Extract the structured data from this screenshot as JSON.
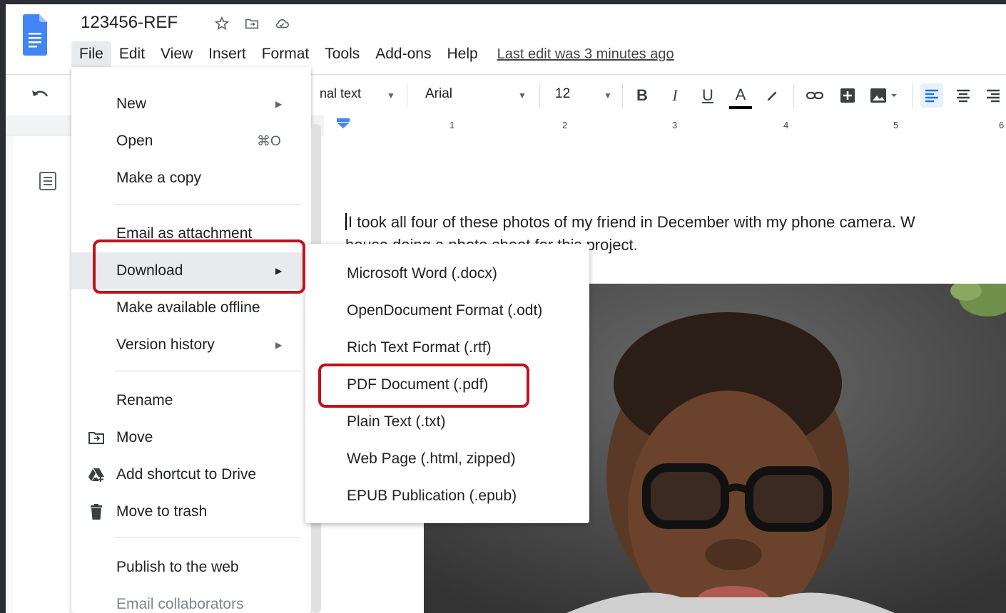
{
  "doc": {
    "title": "123456-REF",
    "last_edit": "Last edit was 3 minutes ago",
    "body_line1": "I took all four of these photos of my friend in December with my phone camera.  W",
    "body_line2": "house doing a photo shoot for this project."
  },
  "menubar": {
    "items": [
      "File",
      "Edit",
      "View",
      "Insert",
      "Format",
      "Tools",
      "Add-ons",
      "Help"
    ]
  },
  "toolbar": {
    "style": "nal text",
    "font": "Arial",
    "size": "12",
    "bold": "B",
    "italic": "I",
    "underline": "U",
    "text_color": "A"
  },
  "ruler": {
    "numbers": [
      "1",
      "2",
      "3",
      "4",
      "5",
      "6"
    ]
  },
  "file_menu": {
    "new": "New",
    "open": "Open",
    "open_shortcut": "⌘O",
    "make_copy": "Make a copy",
    "email_attachment": "Email as attachment",
    "download": "Download",
    "offline": "Make available offline",
    "version_history": "Version history",
    "rename": "Rename",
    "move": "Move",
    "add_shortcut": "Add shortcut to Drive",
    "trash": "Move to trash",
    "publish": "Publish to the web",
    "email_collab": "Email collaborators"
  },
  "download_menu": {
    "items": [
      "Microsoft Word (.docx)",
      "OpenDocument Format (.odt)",
      "Rich Text Format (.rtf)",
      "PDF Document (.pdf)",
      "Plain Text (.txt)",
      "Web Page (.html, zipped)",
      "EPUB Publication (.epub)"
    ]
  },
  "colors": {
    "highlight": "#c0121c",
    "docs_blue": "#4285f4"
  }
}
